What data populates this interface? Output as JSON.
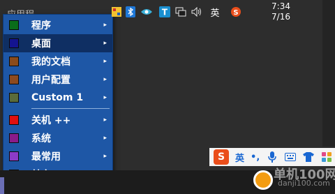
{
  "desktop": {
    "title": "应用程"
  },
  "start_menu": {
    "items": [
      {
        "label": "程序",
        "color": "#0a6d1a",
        "submenu": true
      },
      {
        "label": "桌面",
        "color": "#14148f",
        "submenu": true,
        "highlighted": true
      },
      {
        "label": "我的文档",
        "color": "#8a4b1c",
        "submenu": true
      },
      {
        "label": "用户配置",
        "color": "#8c4a1f",
        "submenu": true
      },
      {
        "label": "Custom 1",
        "color": "#5a6b3a",
        "submenu": true
      },
      {
        "label": "关机 ++",
        "color": "#e01010",
        "submenu": true
      },
      {
        "label": "系统",
        "color": "#8a1b8a",
        "submenu": true
      },
      {
        "label": "最常用",
        "color": "#8c3bc8",
        "submenu": true
      },
      {
        "label": "其它",
        "color": "#9a8ad0",
        "submenu": true
      }
    ],
    "submenu_arrow": "▸"
  },
  "ime_bar": {
    "logo": "S",
    "language": "英",
    "punctuation": "•,",
    "icons": [
      "microphone-icon",
      "keyboard-icon",
      "skin-shirt-icon",
      "toolbox-grid-icon"
    ]
  },
  "taskbar": {
    "language": "英",
    "clock_time": "7:34",
    "clock_date": "7/16",
    "tray_icons": [
      "app-icon",
      "bluetooth-icon",
      "eye-care-icon",
      "t-app-icon",
      "network-icon",
      "volume-icon",
      "ime-icon"
    ]
  },
  "watermark": {
    "text": "单机100网",
    "url": "danji100.com"
  },
  "colors": {
    "menu_bg": "#1e57a6",
    "menu_highlight": "#0f2f63",
    "taskbar_bg": "#1c1c1c",
    "desktop_bg": "#2d2d2d"
  }
}
